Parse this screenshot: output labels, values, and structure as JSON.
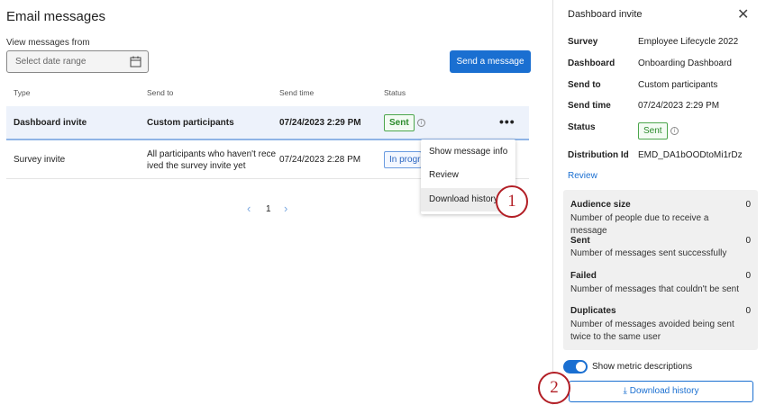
{
  "title": "Email messages",
  "filter": {
    "label": "View messages from",
    "placeholder": "Select date range"
  },
  "send_button": "Send a message",
  "table": {
    "headers": [
      "Type",
      "Send to",
      "Send time",
      "Status"
    ],
    "rows": [
      {
        "type": "Dashboard invite",
        "send_to": "Custom participants",
        "send_time": "07/24/2023 2:29 PM",
        "status": "Sent"
      },
      {
        "type": "Survey invite",
        "send_to": "All participants who haven't receive ived the survey invite yet",
        "send_to_l1": "All participants who haven't rece",
        "send_to_l2": "ived the survey invite yet",
        "send_time": "07/24/2023 2:28 PM",
        "status": "In progress"
      }
    ]
  },
  "menu": [
    "Show message info",
    "Review",
    "Download history"
  ],
  "pagination": {
    "page": "1"
  },
  "callouts": [
    "1",
    "2"
  ],
  "panel": {
    "title": "Dashboard invite",
    "fields": [
      {
        "k": "Survey",
        "v": "Employee Lifecycle 2022"
      },
      {
        "k": "Dashboard",
        "v": "Onboarding Dashboard"
      },
      {
        "k": "Send to",
        "v": "Custom participants"
      },
      {
        "k": "Send time",
        "v": "07/24/2023 2:29 PM"
      },
      {
        "k": "Status",
        "v": "Sent"
      },
      {
        "k": "Distribution Id",
        "v": "EMD_DA1bOODtoMi1rDz"
      }
    ],
    "review_link": "Review",
    "stats": [
      {
        "k": "Audience size",
        "n": "0",
        "d": "Number of people due to receive a message"
      },
      {
        "k": "Sent",
        "n": "0",
        "d": "Number of messages sent successfully"
      },
      {
        "k": "Failed",
        "n": "0",
        "d": "Number of messages that couldn't be sent"
      },
      {
        "k": "Duplicates",
        "n": "0",
        "d": "Number of messages avoided being sent twice to the same user"
      }
    ],
    "toggle_label": "Show metric descriptions",
    "toggle_on": true,
    "download_button": "Download history"
  }
}
